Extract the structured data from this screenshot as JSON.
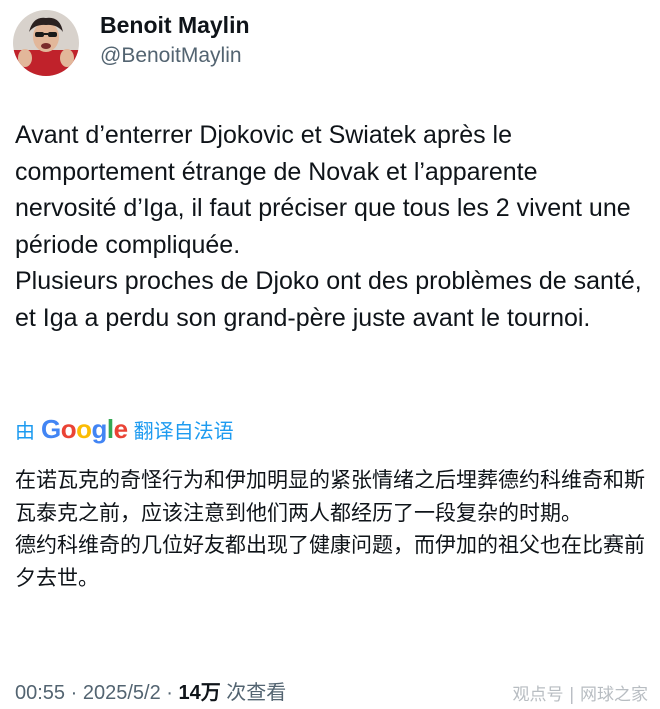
{
  "author": {
    "display_name": "Benoit Maylin",
    "handle": "@BenoitMaylin",
    "avatar_icon": "profile-photo"
  },
  "tweet": {
    "paragraphs": [
      "Avant d’enterrer Djokovic et Swiatek après le comportement étrange de Novak et l’apparente nervosité d’Iga, il faut préciser que tous les 2 vivent une période compliquée.",
      "Plusieurs proches de Djoko ont des problèmes de santé, et Iga a perdu son grand-père juste avant le tournoi."
    ]
  },
  "translation_bar": {
    "by_label": "由",
    "provider": "Google",
    "translated_label": "翻译自法语"
  },
  "translation": {
    "paragraphs": [
      "在诺瓦克的奇怪行为和伊加明显的紧张情绪之后埋葬德约科维奇和斯瓦泰克之前，应该注意到他们两人都经历了一段复杂的时期。",
      "德约科维奇的几位好友都出现了健康问题，而伊加的祖父也在比赛前夕去世。"
    ]
  },
  "meta": {
    "time": "00:55",
    "separator": " · ",
    "date": "2025/5/2",
    "views_count": "14万",
    "views_label": " 次查看"
  },
  "watermark": "观点号 | 网球之家",
  "colors": {
    "text": "#0f1419",
    "secondary_text": "#536471",
    "link_blue": "#1d9bf0",
    "background": "#ffffff"
  }
}
